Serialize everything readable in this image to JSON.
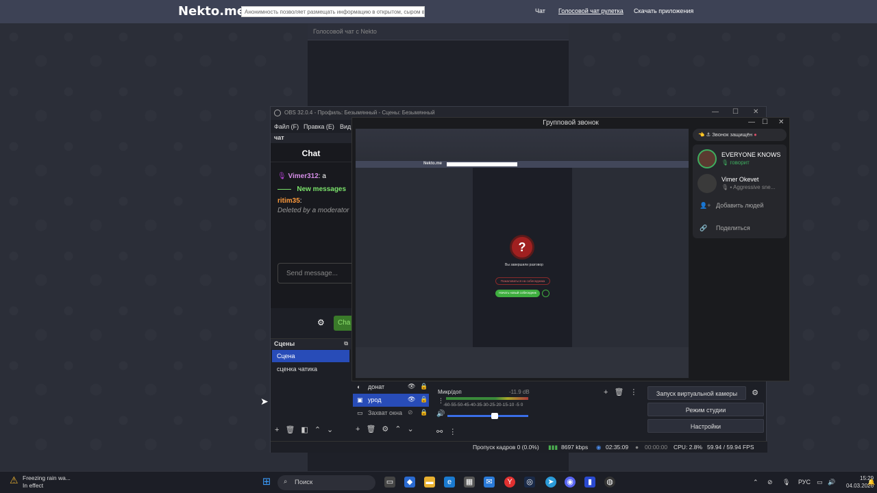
{
  "nekto": {
    "logo": "Nekto.me",
    "notice": "Анонимность позволяет размещать информацию в открытом, сыром виде!",
    "nav": [
      "Чат",
      "Голосовой чат рулетка",
      "Скачать приложения"
    ],
    "panel_title": "Голосовой чат с Nekto"
  },
  "obs": {
    "title": "OBS 32.0.4 - Профиль: Безымянный - Сцены: Безымянный",
    "menu": [
      "Файл (F)",
      "Правка (E)",
      "Вид"
    ],
    "chat_dock_title": "чат",
    "chat": {
      "header": "Chat",
      "msg1_user": "Vimer312",
      "msg1_text": ": a",
      "new_messages": "New messages",
      "msg2_user": "ritim35",
      "msg2_text": ":",
      "deleted": "Deleted by a moderator",
      "input_placeholder": "Send message...",
      "chat_button": "Cha"
    },
    "scenes_title": "Сцены",
    "scenes": [
      "Сцена",
      "сценка чатика"
    ],
    "sources": [
      {
        "label": "донат",
        "icon": "globe-icon"
      },
      {
        "label": "урод",
        "icon": "image-icon"
      },
      {
        "label": "Захват окна",
        "icon": "window-icon"
      }
    ],
    "mixer": {
      "name": "Микр/доп",
      "db": "-11.9 dB",
      "scale": "-60-55-50-45-40-35-30-25-20-15-10 -5  0",
      "volume": 0.6
    },
    "controls": [
      "Запуск виртуальной камеры",
      "Режим студии",
      "Настройки"
    ],
    "status": {
      "dropped": "Пропуск кадров 0 (0.0%)",
      "kbps": "8697 kbps",
      "live_time": "02:35:09",
      "rec_time": "00:00:00",
      "cpu": "CPU: 2.8%",
      "fps": "59.94 / 59.94 FPS"
    }
  },
  "call": {
    "title": "Групповой звонок",
    "secure": "Звонок защищён",
    "members": [
      {
        "name": "EVERYONE KNOWS",
        "status": "говорит"
      },
      {
        "name": "Vimer Okevet",
        "status": "Aggressive sne..."
      }
    ],
    "add_people": "Добавить людей",
    "share": "Поделиться",
    "stream": {
      "logo": "Nekto.me",
      "ended": "Вы завершили разговор",
      "complain": "Пожаловаться на собеседника",
      "new_chat": "Начать новый собеседник"
    }
  },
  "taskbar": {
    "weather_title": "Freezing rain wa...",
    "weather_sub": "In effect",
    "search": "Поиск",
    "lang": "РУС",
    "time": "15:29",
    "date": "04.03.2026"
  }
}
